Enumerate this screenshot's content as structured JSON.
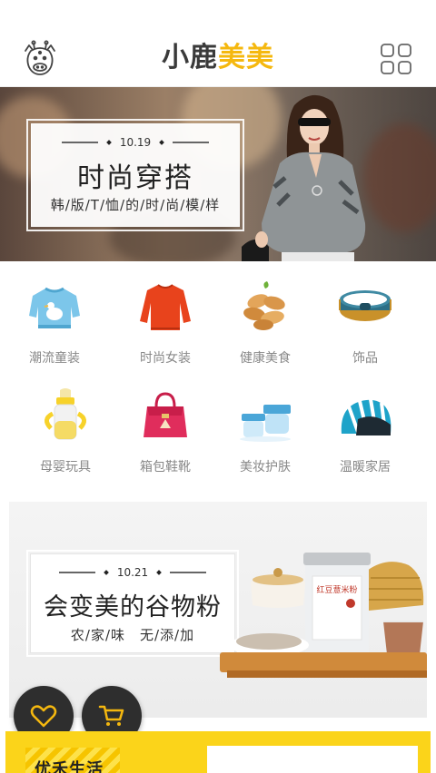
{
  "header": {
    "logo_icon": "giraffe-icon",
    "title_part1": "小鹿",
    "title_part2": "美美",
    "menu_icon": "grid-icon",
    "accent_color": "#f5b80f"
  },
  "banner1": {
    "date": "10.19",
    "title": "时尚穿搭",
    "subtitle": "韩/版/T/恤/的/时/尚/模/样"
  },
  "categories": [
    {
      "label": "潮流童装",
      "icon": "kids-sweater-icon"
    },
    {
      "label": "时尚女装",
      "icon": "womens-sweater-icon"
    },
    {
      "label": "健康美食",
      "icon": "peanuts-icon"
    },
    {
      "label": "饰品",
      "icon": "bracelet-icon"
    },
    {
      "label": "母婴玩具",
      "icon": "baby-bottle-icon"
    },
    {
      "label": "箱包鞋靴",
      "icon": "handbag-icon"
    },
    {
      "label": "美妆护肤",
      "icon": "cosmetics-jar-icon"
    },
    {
      "label": "温暖家居",
      "icon": "beanbag-icon"
    }
  ],
  "banner2": {
    "date": "10.21",
    "title": "会变美的谷物粉",
    "subtitle": "农/家/味　无/添/加",
    "product_label": "红豆薏米粉"
  },
  "fabs": {
    "favorite_icon": "heart-icon",
    "cart_icon": "cart-icon"
  },
  "bottom": {
    "label": "优禾生活"
  }
}
